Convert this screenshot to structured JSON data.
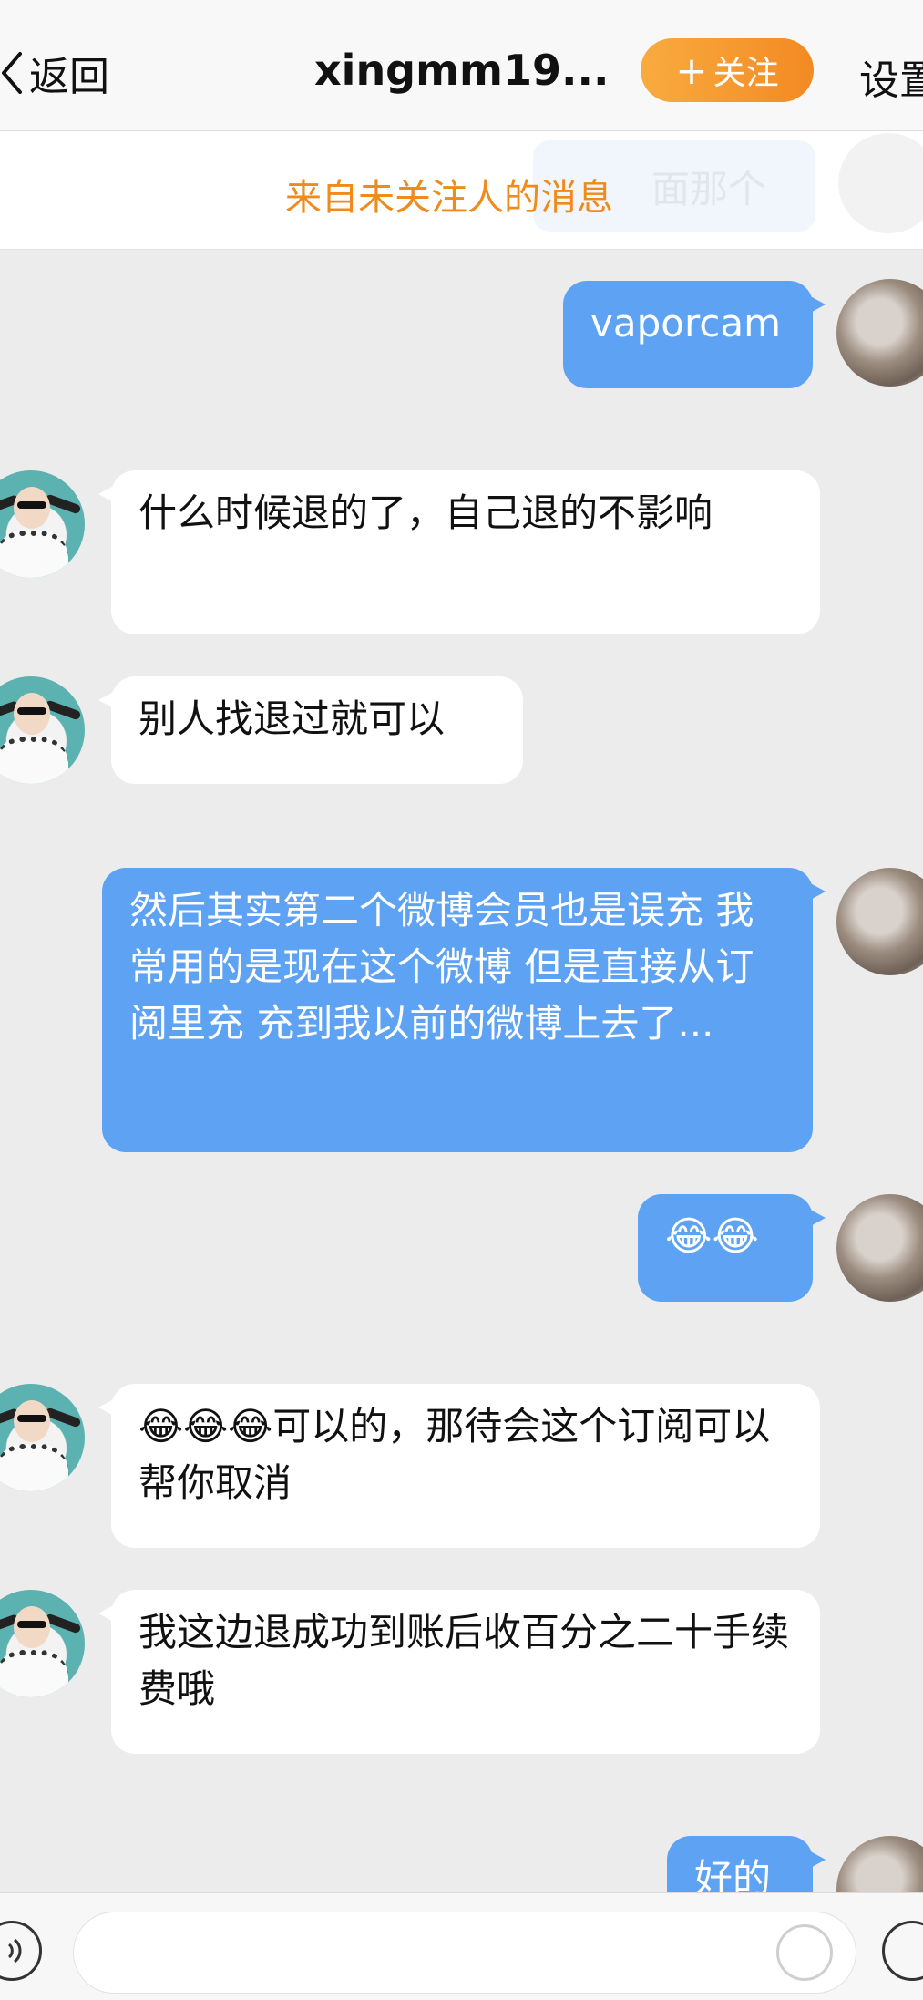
{
  "header": {
    "back_label": "返回",
    "title": "xingmm19...",
    "follow_label": "关注",
    "follow_plus": "+",
    "settings_label": "设置"
  },
  "notice": {
    "text": "来自未关注人的消息",
    "ghost_text": "面那个"
  },
  "messages": [
    {
      "from": "me",
      "text": "vaporcam"
    },
    {
      "from": "other",
      "text": "什么时候退的了，自己退的不影响"
    },
    {
      "from": "other",
      "text": "别人找退过就可以"
    },
    {
      "from": "me",
      "text": "然后其实第二个微博会员也是误充 我常用的是现在这个微博 但是直接从订阅里充 充到我以前的微博上去了..."
    },
    {
      "from": "me",
      "text": "😂😂"
    },
    {
      "from": "other",
      "text": "😂😂😂可以的，那待会这个订阅可以帮你取消"
    },
    {
      "from": "other",
      "text": "我这边退成功到账后收百分之二十手续费哦"
    },
    {
      "from": "me",
      "text": "好的"
    }
  ],
  "input": {
    "placeholder": ""
  },
  "colors": {
    "accent": "#f38a23",
    "outgoing_bubble": "#5ea2f3",
    "background": "#ececec"
  }
}
